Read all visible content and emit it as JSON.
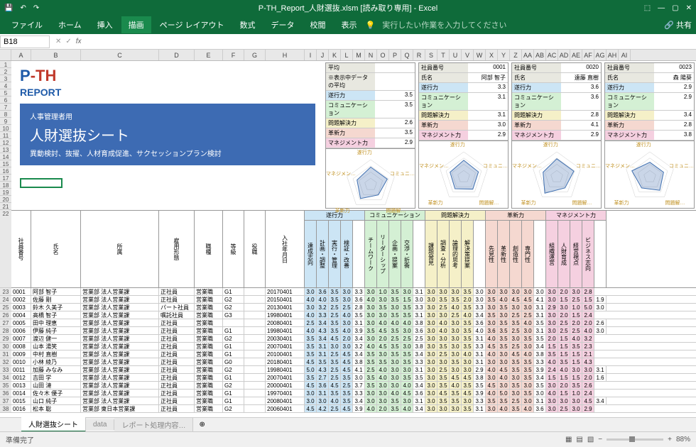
{
  "app": {
    "title": "P-TH_Report_人財選抜.xlsm [読み取り専用] - Excel",
    "share": "共有"
  },
  "ribbon": {
    "tabs": [
      "ファイル",
      "ホーム",
      "挿入",
      "描画",
      "ページ レイアウト",
      "数式",
      "データ",
      "校閲",
      "表示"
    ],
    "active": 3,
    "tell": "実行したい作業を入力してください"
  },
  "formula": {
    "cell": "B18"
  },
  "columns": [
    "A",
    "B",
    "C",
    "D",
    "E",
    "F",
    "G",
    "H",
    "I",
    "J",
    "K",
    "L",
    "M",
    "N",
    "O",
    "P",
    "Q",
    "R",
    "S",
    "T",
    "U",
    "V",
    "W",
    "X",
    "Y",
    "Z",
    "AA",
    "AB",
    "AC",
    "AD",
    "AE",
    "AF",
    "AG",
    "AH",
    "AI"
  ],
  "rows_top": [
    "1",
    "2",
    "3",
    "4",
    "5",
    "6",
    "7",
    "8",
    "9",
    "10",
    "11",
    "12",
    "13",
    "14",
    "15",
    "16",
    "17",
    "18",
    "19",
    "20",
    "21"
  ],
  "logo": {
    "p": "P",
    "th": "-TH",
    "report": "REPORT"
  },
  "titlebox": {
    "sub": "人事管理者用",
    "main": "人財選抜シート",
    "desc": "異動検討、抜擢、人材育成促進、サクセッションプラン検討"
  },
  "cards": [
    {
      "header": [
        [
          "平均",
          "　"
        ],
        [
          "※表示中データの平均",
          "　"
        ]
      ],
      "metrics": [
        [
          "遂行力",
          "3.5"
        ],
        [
          "コミュニケーション",
          "3.5"
        ],
        [
          "問題解決力",
          "2.6"
        ],
        [
          "革新力",
          "3.5"
        ],
        [
          "マネジメント力",
          "2.9"
        ]
      ]
    },
    {
      "header": [
        [
          "社員番号",
          "0001"
        ],
        [
          "氏名",
          "阿部 智子"
        ]
      ],
      "metrics": [
        [
          "遂行力",
          "3.3"
        ],
        [
          "コミュニケーション",
          "3.1"
        ],
        [
          "問題解決力",
          "3.1"
        ],
        [
          "革新力",
          "3.0"
        ],
        [
          "マネジメント力",
          "2.9"
        ]
      ]
    },
    {
      "header": [
        [
          "社員番号",
          "0020"
        ],
        [
          "氏名",
          "遠藤 直樹"
        ]
      ],
      "metrics": [
        [
          "遂行力",
          "3.6"
        ],
        [
          "コミュニケーション",
          "3.6"
        ],
        [
          "問題解決力",
          "2.8"
        ],
        [
          "革新力",
          "4.1"
        ],
        [
          "マネジメント力",
          "2.9"
        ]
      ]
    },
    {
      "header": [
        [
          "社員番号",
          "0023"
        ],
        [
          "氏名",
          "森 陽葵"
        ]
      ],
      "metrics": [
        [
          "遂行力",
          "2.9"
        ],
        [
          "コミュニケーション",
          "2.9"
        ],
        [
          "問題解決力",
          "3.4"
        ],
        [
          "革新力",
          "2.8"
        ],
        [
          "マネジメント力",
          "3.8"
        ]
      ]
    }
  ],
  "radar_labels": [
    "遂行力",
    "コミュニ…",
    "問題解…",
    "革新力",
    "マネジメン…"
  ],
  "grid": {
    "fixed_headers": [
      "社員番号",
      "氏名",
      "所属",
      "雇用形態",
      "職種",
      "等級",
      "役職",
      "入社年月日"
    ],
    "groups": [
      {
        "title": "遂行力",
        "cls": "gc1",
        "cols": [
          "達成志向",
          "計画・調整",
          "実行・管理",
          "検証・改善"
        ]
      },
      {
        "title": "コミュニケーション",
        "cls": "gc2",
        "cols": [
          "チームワーク",
          "リーダーシップ",
          "企画・提案",
          "交渉・折衝"
        ]
      },
      {
        "title": "問題解決力",
        "cls": "gc3",
        "cols": [
          "課題発見",
          "調査・分析",
          "論理的思考",
          "解決策提案"
        ]
      },
      {
        "title": "革新力",
        "cls": "gc4",
        "cols": [
          "先見性",
          "革新性",
          "創造性",
          "専門性"
        ]
      },
      {
        "title": "マネジメント力",
        "cls": "gc5",
        "cols": [
          "組織運営",
          "人財育成",
          "経営視点",
          "ビジネス志向"
        ]
      }
    ],
    "rows": [
      {
        "no": "23",
        "id": "0001",
        "name": "阿部 智子",
        "dept": "営業部 法人営業課",
        "emp": "正社員",
        "job": "営業職",
        "grade": "G1",
        "pos": "",
        "hire": "20170401",
        "v": [
          "3.0",
          "3.6",
          "3.5",
          "3.0",
          "3.3",
          "3.0",
          "1.0",
          "3.5",
          "3.0",
          "3.1",
          "3.0",
          "3.0",
          "3.0",
          "3.5",
          "3.0",
          "3.0",
          "3.0",
          "3.0",
          "3.0",
          "3.0",
          "3.0",
          "2.0",
          "3.0",
          "2.8"
        ]
      },
      {
        "no": "24",
        "id": "0002",
        "name": "佐藤 剛",
        "dept": "営業部 法人営業課",
        "emp": "正社員",
        "job": "営業職",
        "grade": "G2",
        "pos": "",
        "hire": "20150401",
        "v": [
          "4.0",
          "4.0",
          "3.5",
          "3.0",
          "3.6",
          "4.0",
          "3.0",
          "3.5",
          "1.5",
          "3.0",
          "3.0",
          "3.5",
          "3.5",
          "2.0",
          "3.0",
          "3.5",
          "4.0",
          "4.5",
          "4.5",
          "4.1",
          "3.0",
          "1.5",
          "2.5",
          "1.5",
          "1.9"
        ]
      },
      {
        "no": "25",
        "id": "0003",
        "name": "鈴木 久美子",
        "dept": "営業部 法人営業課",
        "emp": "パート社員",
        "job": "営業職",
        "grade": "G2",
        "pos": "",
        "hire": "20130401",
        "v": [
          "3.0",
          "3.2",
          "2.5",
          "2.5",
          "2.8",
          "3.0",
          "3.5",
          "3.0",
          "3.5",
          "3.3",
          "3.0",
          "2.5",
          "4.0",
          "3.5",
          "3.3",
          "3.0",
          "3.5",
          "3.0",
          "3.0",
          "3.1",
          "2.9",
          "3.0",
          "1.0",
          "5.0",
          "3.0"
        ]
      },
      {
        "no": "26",
        "id": "0004",
        "name": "高橋 智子",
        "dept": "営業部 法人営業課",
        "emp": "嘱託社員",
        "job": "営業職",
        "grade": "G3",
        "pos": "",
        "hire": "19980401",
        "v": [
          "4.0",
          "3.3",
          "2.5",
          "4.0",
          "3.5",
          "3.0",
          "3.0",
          "3.5",
          "3.5",
          "3.1",
          "3.0",
          "3.0",
          "2.5",
          "4.0",
          "3.4",
          "3.5",
          "3.0",
          "2.5",
          "2.5",
          "3.1",
          "3.0",
          "2.0",
          "1.5",
          "2.4"
        ]
      },
      {
        "no": "27",
        "id": "0005",
        "name": "田中 理恵",
        "dept": "営業部 法人営業課",
        "emp": "正社員",
        "job": "営業職",
        "grade": "　",
        "pos": "",
        "hire": "20080401",
        "v": [
          "2.5",
          "3.4",
          "3.5",
          "3.0",
          "3.1",
          "3.0",
          "4.0",
          "4.0",
          "4.0",
          "3.8",
          "3.0",
          "4.0",
          "3.0",
          "3.5",
          "3.6",
          "3.0",
          "3.5",
          "3.5",
          "4.0",
          "3.5",
          "3.0",
          "2.5",
          "2.0",
          "2.0",
          "2.6"
        ]
      },
      {
        "no": "28",
        "id": "0006",
        "name": "伊藤 純子",
        "dept": "営業部 法人営業課",
        "emp": "正社員",
        "job": "営業職",
        "grade": "G1",
        "pos": "",
        "hire": "19980401",
        "v": [
          "4.0",
          "4.3",
          "3.5",
          "4.0",
          "3.9",
          "3.5",
          "4.5",
          "3.5",
          "3.0",
          "3.6",
          "3.0",
          "4.0",
          "3.0",
          "3.5",
          "4.0",
          "3.6",
          "3.5",
          "2.5",
          "3.0",
          "3.1",
          "3.0",
          "2.5",
          "2.5",
          "4.0",
          "3.0"
        ]
      },
      {
        "no": "29",
        "id": "0007",
        "name": "渡辺 健一",
        "dept": "営業部 法人営業課",
        "emp": "正社員",
        "job": "営業職",
        "grade": "G2",
        "pos": "",
        "hire": "20030401",
        "v": [
          "3.5",
          "3.4",
          "4.5",
          "2.0",
          "3.4",
          "3.0",
          "2.0",
          "2.5",
          "2.5",
          "2.5",
          "3.0",
          "3.0",
          "3.0",
          "3.5",
          "3.1",
          "4.0",
          "3.5",
          "3.0",
          "3.5",
          "3.5",
          "2.0",
          "1.5",
          "4.0",
          "3.2"
        ]
      },
      {
        "no": "30",
        "id": "0008",
        "name": "山本 湯笑",
        "dept": "営業部 法人営業課",
        "emp": "正社員",
        "job": "営業職",
        "grade": "G1",
        "pos": "",
        "hire": "20070401",
        "v": [
          "3.5",
          "3.1",
          "3.0",
          "3.0",
          "3.2",
          "4.0",
          "4.5",
          "3.5",
          "3.0",
          "3.8",
          "3.0",
          "3.5",
          "3.0",
          "3.5",
          "3.3",
          "4.5",
          "3.5",
          "2.5",
          "3.0",
          "3.4",
          "1.5",
          "1.5",
          "3.5",
          "2.3"
        ]
      },
      {
        "no": "31",
        "id": "0009",
        "name": "中村 直樹",
        "dept": "営業部 法人営業課",
        "emp": "正社員",
        "job": "営業職",
        "grade": "G1",
        "pos": "",
        "hire": "20100401",
        "v": [
          "3.5",
          "3.1",
          "2.5",
          "4.5",
          "3.4",
          "3.5",
          "3.0",
          "3.5",
          "3.5",
          "3.4",
          "3.0",
          "2.5",
          "3.0",
          "4.0",
          "3.1",
          "4.0",
          "3.0",
          "4.5",
          "4.0",
          "3.8",
          "3.5",
          "1.5",
          "1.5",
          "2.1"
        ]
      },
      {
        "no": "32",
        "id": "0010",
        "name": "小林 綾乃",
        "dept": "営業部 法人営業課",
        "emp": "正社員",
        "job": "営業職",
        "grade": "G0",
        "pos": "",
        "hire": "20180401",
        "v": [
          "4.5",
          "3.5",
          "3.5",
          "4.5",
          "3.8",
          "3.5",
          "3.5",
          "3.0",
          "3.5",
          "3.3",
          "3.0",
          "3.0",
          "3.5",
          "3.0",
          "3.1",
          "3.0",
          "3.0",
          "3.5",
          "3.5",
          "3.3",
          "4.0",
          "3.5",
          "1.5",
          "4.3"
        ]
      },
      {
        "no": "33",
        "id": "0011",
        "name": "加藤 みなみ",
        "dept": "営業部 法人営業課",
        "emp": "正社員",
        "job": "営業職",
        "grade": "G2",
        "pos": "",
        "hire": "19980401",
        "v": [
          "5.0",
          "4.3",
          "2.5",
          "4.5",
          "4.1",
          "2.5",
          "4.0",
          "3.0",
          "3.0",
          "3.1",
          "3.0",
          "2.5",
          "3.0",
          "3.0",
          "2.9",
          "4.0",
          "4.5",
          "3.5",
          "3.5",
          "3.9",
          "2.4",
          "4.0",
          "3.0",
          "3.0",
          "3.1"
        ]
      },
      {
        "no": "34",
        "id": "0012",
        "name": "吉田 学",
        "dept": "営業部 法人営業課",
        "emp": "正社員",
        "job": "営業職",
        "grade": "G1",
        "pos": "",
        "hire": "20070401",
        "v": [
          "3.5",
          "2.7",
          "2.5",
          "3.5",
          "3.0",
          "3.5",
          "4.0",
          "3.0",
          "3.5",
          "3.5",
          "3.0",
          "3.5",
          "4.5",
          "4.5",
          "3.8",
          "3.0",
          "4.0",
          "3.0",
          "3.5",
          "3.4",
          "1.5",
          "1.5",
          "1.5",
          "2.0",
          "1.6"
        ]
      },
      {
        "no": "35",
        "id": "0013",
        "name": "山田 漣",
        "dept": "営業部 法人営業課",
        "emp": "正社員",
        "job": "営業職",
        "grade": "G2",
        "pos": "",
        "hire": "20000401",
        "v": [
          "4.5",
          "3.6",
          "4.5",
          "2.5",
          "3.7",
          "3.5",
          "3.0",
          "3.0",
          "4.0",
          "3.4",
          "3.0",
          "3.5",
          "4.0",
          "3.5",
          "3.5",
          "4.5",
          "3.0",
          "3.5",
          "3.0",
          "3.5",
          "3.0",
          "2.0",
          "3.5",
          "2.6"
        ]
      },
      {
        "no": "36",
        "id": "0014",
        "name": "佐々木 優子",
        "dept": "営業部 法人営業課",
        "emp": "正社員",
        "job": "営業職",
        "grade": "G1",
        "pos": "",
        "hire": "19970401",
        "v": [
          "3.0",
          "3.1",
          "3.5",
          "3.5",
          "3.3",
          "3.0",
          "3.0",
          "4.0",
          "4.5",
          "3.6",
          "3.0",
          "4.5",
          "3.5",
          "4.5",
          "3.9",
          "4.0",
          "5.0",
          "3.0",
          "3.5",
          "3.0",
          "4.0",
          "1.5",
          "1.0",
          "2.4"
        ]
      },
      {
        "no": "37",
        "id": "0015",
        "name": "山口 純子",
        "dept": "営業部 法人営業課",
        "emp": "正社員",
        "job": "営業職",
        "grade": "G1",
        "pos": "",
        "hire": "20080401",
        "v": [
          "3.0",
          "3.0",
          "4.0",
          "3.5",
          "3.4",
          "3.0",
          "3.0",
          "3.5",
          "3.0",
          "3.1",
          "3.0",
          "3.5",
          "3.5",
          "3.0",
          "3.3",
          "3.5",
          "3.5",
          "2.5",
          "3.0",
          "3.1",
          "3.0",
          "3.0",
          "3.0",
          "4.5",
          "3.4"
        ]
      },
      {
        "no": "38",
        "id": "0016",
        "name": "松本 聡",
        "dept": "営業部 東日本営業課",
        "emp": "正社員",
        "job": "営業職",
        "grade": "G2",
        "pos": "",
        "hire": "20060401",
        "v": [
          "4.5",
          "4.2",
          "2.5",
          "4.5",
          "3.9",
          "4.0",
          "2.0",
          "3.5",
          "4.0",
          "3.4",
          "3.0",
          "3.0",
          "3.0",
          "3.5",
          "3.1",
          "3.0",
          "4.0",
          "3.5",
          "4.0",
          "3.6",
          "3.0",
          "2.5",
          "3.0",
          "2.9"
        ]
      }
    ]
  },
  "sheets": {
    "tabs": [
      "人財選抜シート",
      "data",
      "レポート処理内容…"
    ],
    "add": "⊕"
  },
  "status": {
    "ready": "準備完了",
    "zoom": "88%"
  },
  "chart_data": [
    {
      "type": "radar",
      "categories": [
        "遂行力",
        "コミュニ",
        "問題解",
        "革新力",
        "マネジメン"
      ],
      "values": [
        3.5,
        3.5,
        2.6,
        3.5,
        2.9
      ],
      "title": "平均"
    },
    {
      "type": "radar",
      "categories": [
        "遂行力",
        "コミュニ",
        "問題解",
        "革新力",
        "マネジメン"
      ],
      "values": [
        3.3,
        3.1,
        3.1,
        3.0,
        2.9
      ],
      "title": "0001"
    },
    {
      "type": "radar",
      "categories": [
        "遂行力",
        "コミュニ",
        "問題解",
        "革新力",
        "マネジメン"
      ],
      "values": [
        3.6,
        3.6,
        2.8,
        4.1,
        2.9
      ],
      "title": "0020"
    },
    {
      "type": "radar",
      "categories": [
        "遂行力",
        "コミュニ",
        "問題解",
        "革新力",
        "マネジメン"
      ],
      "values": [
        2.9,
        2.9,
        3.4,
        2.8,
        3.8
      ],
      "title": "0023"
    }
  ]
}
